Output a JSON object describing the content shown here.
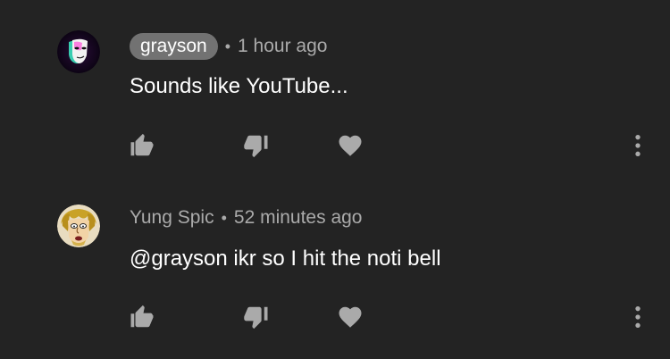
{
  "comments": [
    {
      "author": "grayson",
      "author_highlighted": true,
      "separator": "•",
      "time": "1 hour ago",
      "text": "Sounds like YouTube...",
      "avatar_icon": "theater-mask-avatar-icon"
    },
    {
      "author": "Yung Spic",
      "author_highlighted": false,
      "separator": "•",
      "time": "52 minutes ago",
      "text": "@grayson ikr so I hit the noti bell",
      "avatar_icon": "cartoon-face-avatar-icon"
    }
  ],
  "actions": {
    "like_icon": "thumbs-up-icon",
    "dislike_icon": "thumbs-down-icon",
    "heart_icon": "heart-icon",
    "more_icon": "more-vertical-icon"
  },
  "colors": {
    "background": "#232323",
    "meta_text": "#aaaaaa",
    "chip_background": "#727272",
    "icon": "#aaaaaa"
  }
}
